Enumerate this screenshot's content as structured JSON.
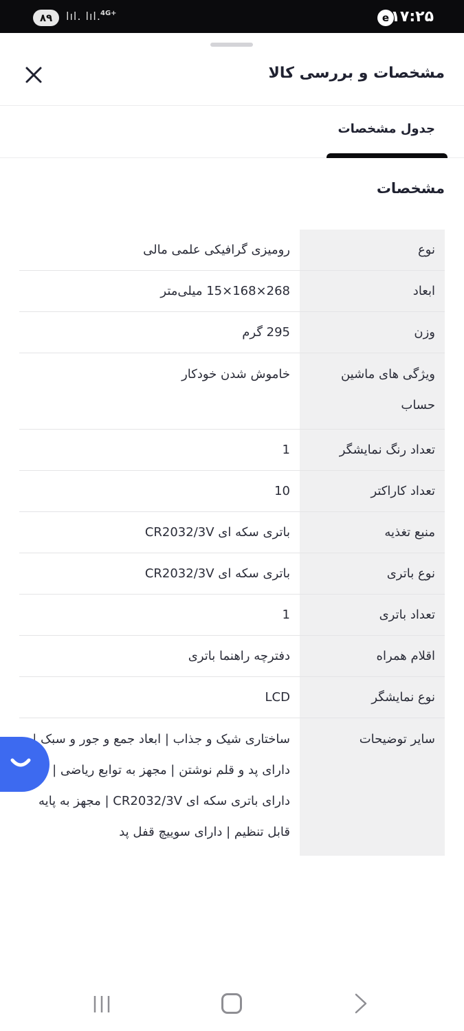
{
  "status_bar": {
    "time": "۱۷:۲۵",
    "battery": "۸۹",
    "network": "4G+",
    "signal_text": "lıl. lıl."
  },
  "header": {
    "title": "مشخصات و بررسی کالا"
  },
  "tabs": [
    {
      "label": "جدول مشخصات",
      "active": true
    }
  ],
  "section": {
    "title": "مشخصات"
  },
  "specs": [
    {
      "key": "نوع",
      "value": "رومیزی گرافیکی علمی مالی"
    },
    {
      "key": "ابعاد",
      "value": "268×168×15 میلی‌متر"
    },
    {
      "key": "وزن",
      "value": "295 گرم"
    },
    {
      "key": "ویژگی های ماشین حساب",
      "value": "خاموش شدن خودکار"
    },
    {
      "key": "تعداد رنگ نمایشگر",
      "value": "1"
    },
    {
      "key": "تعداد کاراکتر",
      "value": "10"
    },
    {
      "key": "منبع تغذیه",
      "value": "باتری سکه ای CR2032/3V"
    },
    {
      "key": "نوع باتری",
      "value": "باتری سکه ای CR2032/3V"
    },
    {
      "key": "تعداد باتری",
      "value": "1"
    },
    {
      "key": "اقلام همراه",
      "value": "دفترچه راهنما باتری"
    },
    {
      "key": "نوع نمایشگر",
      "value": "LCD"
    },
    {
      "key": "سایر توضیحات",
      "value": "ساختاری شیک و جذاب | ابعاد جمع و جور و سبک | دارای پد و قلم نوشتن | مجهز به توابع ریاضی | دارای باتری سکه ای CR2032/3V | مجهز به پایه قابل تنظیم | دارای سوییچ قفل پد"
    }
  ],
  "icons": {
    "close": "close-icon",
    "chat": "chat-bubble-icon",
    "nav_recents": "recents-icon",
    "nav_home": "home-icon",
    "nav_back": "back-icon"
  },
  "colors": {
    "accent": "#3d6af0",
    "tab_indicator": "#0b0b0d",
    "key_column_bg": "#f0f0f1"
  }
}
